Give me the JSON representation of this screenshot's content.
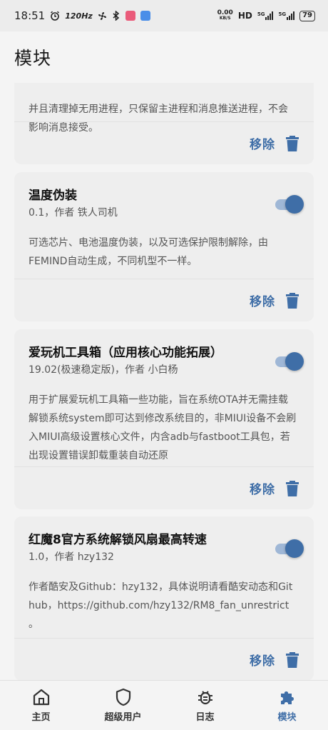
{
  "status_bar": {
    "time": "18:51",
    "refresh_rate": "120Hz",
    "net_speed_value": "0.00",
    "net_speed_unit": "KB/S",
    "hd_label": "HD",
    "signal_1": "5G",
    "signal_2": "5G",
    "battery": "79"
  },
  "header": {
    "title": "模块"
  },
  "modules": [
    {
      "title": "",
      "meta": "",
      "description": "并且清理掉无用进程，只保留主进程和消息推送进程，不会影响消息接受。",
      "remove_label": "移除",
      "enabled": true
    },
    {
      "title": "温度伪装",
      "meta": "0.1，作者 铁人司机",
      "description": "可选芯片、电池温度伪装，以及可选保护限制解除，由FEMIND自动生成，不同机型不一样。",
      "remove_label": "移除",
      "enabled": true
    },
    {
      "title": "爱玩机工具箱（应用核心功能拓展）",
      "meta": "19.02(极速稳定版)，作者 小白杨",
      "description": "用于扩展爱玩机工具箱一些功能，旨在系统OTA并无需挂载解锁系统system即可达到修改系统目的，非MIUI设备不会刷入MIUI高级设置核心文件，内含adb与fastboot工具包，若出现设置错误卸载重装自动还原",
      "remove_label": "移除",
      "enabled": true
    },
    {
      "title": "红魔8官方系统解锁风扇最高转速",
      "meta": "1.0，作者 hzy132",
      "description": "作者酷安及Github：hzy132，具体说明请看酷安动态和Github，https://github.com/hzy132/RM8_fan_unrestrict 。",
      "remove_label": "移除",
      "enabled": true
    }
  ],
  "bottom_nav": {
    "items": [
      {
        "label": "主页",
        "icon": "home-icon"
      },
      {
        "label": "超级用户",
        "icon": "shield-icon"
      },
      {
        "label": "日志",
        "icon": "bug-icon"
      },
      {
        "label": "模块",
        "icon": "puzzle-icon"
      }
    ],
    "active_index": 3
  },
  "colors": {
    "accent": "#3f6ea7",
    "card_bg": "#eeeeee",
    "page_bg": "#f4f4f4"
  }
}
